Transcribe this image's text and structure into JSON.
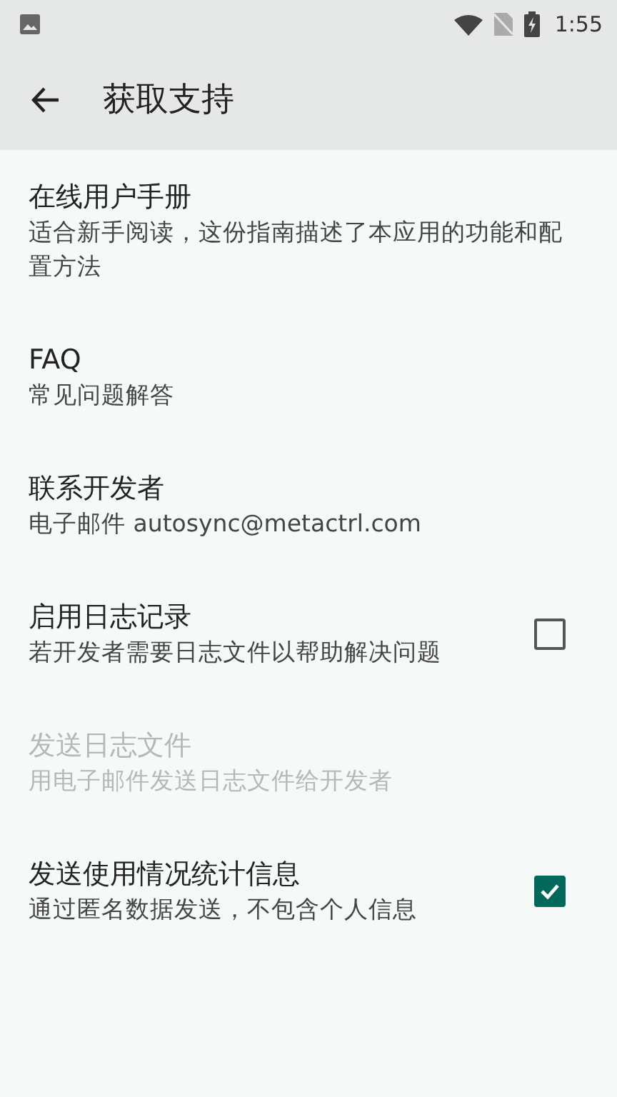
{
  "status_bar": {
    "time": "1:55"
  },
  "toolbar": {
    "title": "获取支持"
  },
  "items": [
    {
      "kind": "plain",
      "title": "在线用户手册",
      "subtitle": "适合新手阅读，这份指南描述了本应用的功能和配置方法",
      "disabled": false
    },
    {
      "kind": "plain",
      "title": "FAQ",
      "subtitle": "常见问题解答",
      "disabled": false
    },
    {
      "kind": "plain",
      "title": "联系开发者",
      "subtitle": "电子邮件 autosync@metactrl.com",
      "disabled": false
    },
    {
      "kind": "checkbox",
      "title": "启用日志记录",
      "subtitle": "若开发者需要日志文件以帮助解决问题",
      "disabled": false,
      "checked": false
    },
    {
      "kind": "plain",
      "title": "发送日志文件",
      "subtitle": "用电子邮件发送日志文件给开发者",
      "disabled": true
    },
    {
      "kind": "checkbox",
      "title": "发送使用情况统计信息",
      "subtitle": "通过匿名数据发送，不包含个人信息",
      "disabled": false,
      "checked": true
    }
  ]
}
